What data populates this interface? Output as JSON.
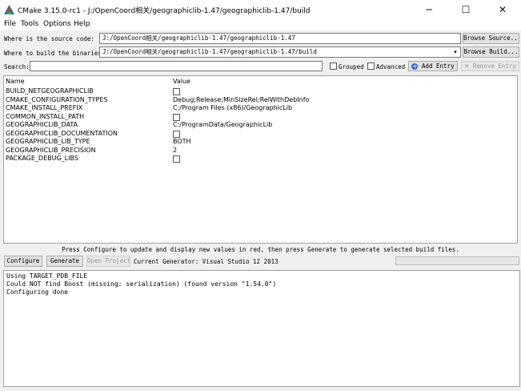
{
  "window": {
    "title": "CMake 3.15.0-rc1 - J:/OpenCoord相关/geographiclib-1.47/geographiclib-1.47/build",
    "minimize": "─",
    "maximize": "☐",
    "close": "✕"
  },
  "menu": [
    "File",
    "Tools",
    "Options",
    "Help"
  ],
  "source": {
    "label": "Where is the source code:",
    "value": "J:/OpenCoord相关/geographiclib-1.47/geographiclib-1.47",
    "browse": "Browse Source..."
  },
  "binaries": {
    "label": "Where to build the binaries:",
    "value": "J:/OpenCoord相关/geographiclib-1.47/geographiclib-1.47/build",
    "browse": "Browse Build..."
  },
  "search": {
    "label": "Search:",
    "value": "",
    "grouped": "Grouped",
    "advanced": "Advanced",
    "add_entry": "Add Entry",
    "remove_entry": "Remove Entry"
  },
  "table": {
    "headers": [
      "Name",
      "Value"
    ],
    "rows": [
      {
        "name": "BUILD_NETGEOGRAPHICLIB",
        "value": "",
        "checkbox": true
      },
      {
        "name": "CMAKE_CONFIGURATION_TYPES",
        "value": "Debug;Release;MinSizeRel;RelWithDebInfo",
        "checkbox": false
      },
      {
        "name": "CMAKE_INSTALL_PREFIX",
        "value": "C:/Program Files (x86)/GeographicLib",
        "checkbox": false
      },
      {
        "name": "COMMON_INSTALL_PATH",
        "value": "",
        "checkbox": true
      },
      {
        "name": "GEOGRAPHICLIB_DATA",
        "value": "C:/ProgramData/GeographicLib",
        "checkbox": false
      },
      {
        "name": "GEOGRAPHICLIB_DOCUMENTATION",
        "value": "",
        "checkbox": true
      },
      {
        "name": "GEOGRAPHICLIB_LIB_TYPE",
        "value": "BOTH",
        "checkbox": false
      },
      {
        "name": "GEOGRAPHICLIB_PRECISION",
        "value": "2",
        "checkbox": false
      },
      {
        "name": "PACKAGE_DEBUG_LIBS",
        "value": "",
        "checkbox": true
      }
    ]
  },
  "status_message": "Press Configure to update and display new values in red, then press Generate to generate selected build files.",
  "actions": {
    "configure": "Configure",
    "generate": "Generate",
    "open_project": "Open Project",
    "generator": "Current Generator: Visual Studio 12 2013",
    "progress": 0
  },
  "output": [
    "Using TARGET_PDB_FILE",
    "Could NOT find Boost (missing: serialization) (found version \"1.54.0\")",
    "Configuring done"
  ]
}
